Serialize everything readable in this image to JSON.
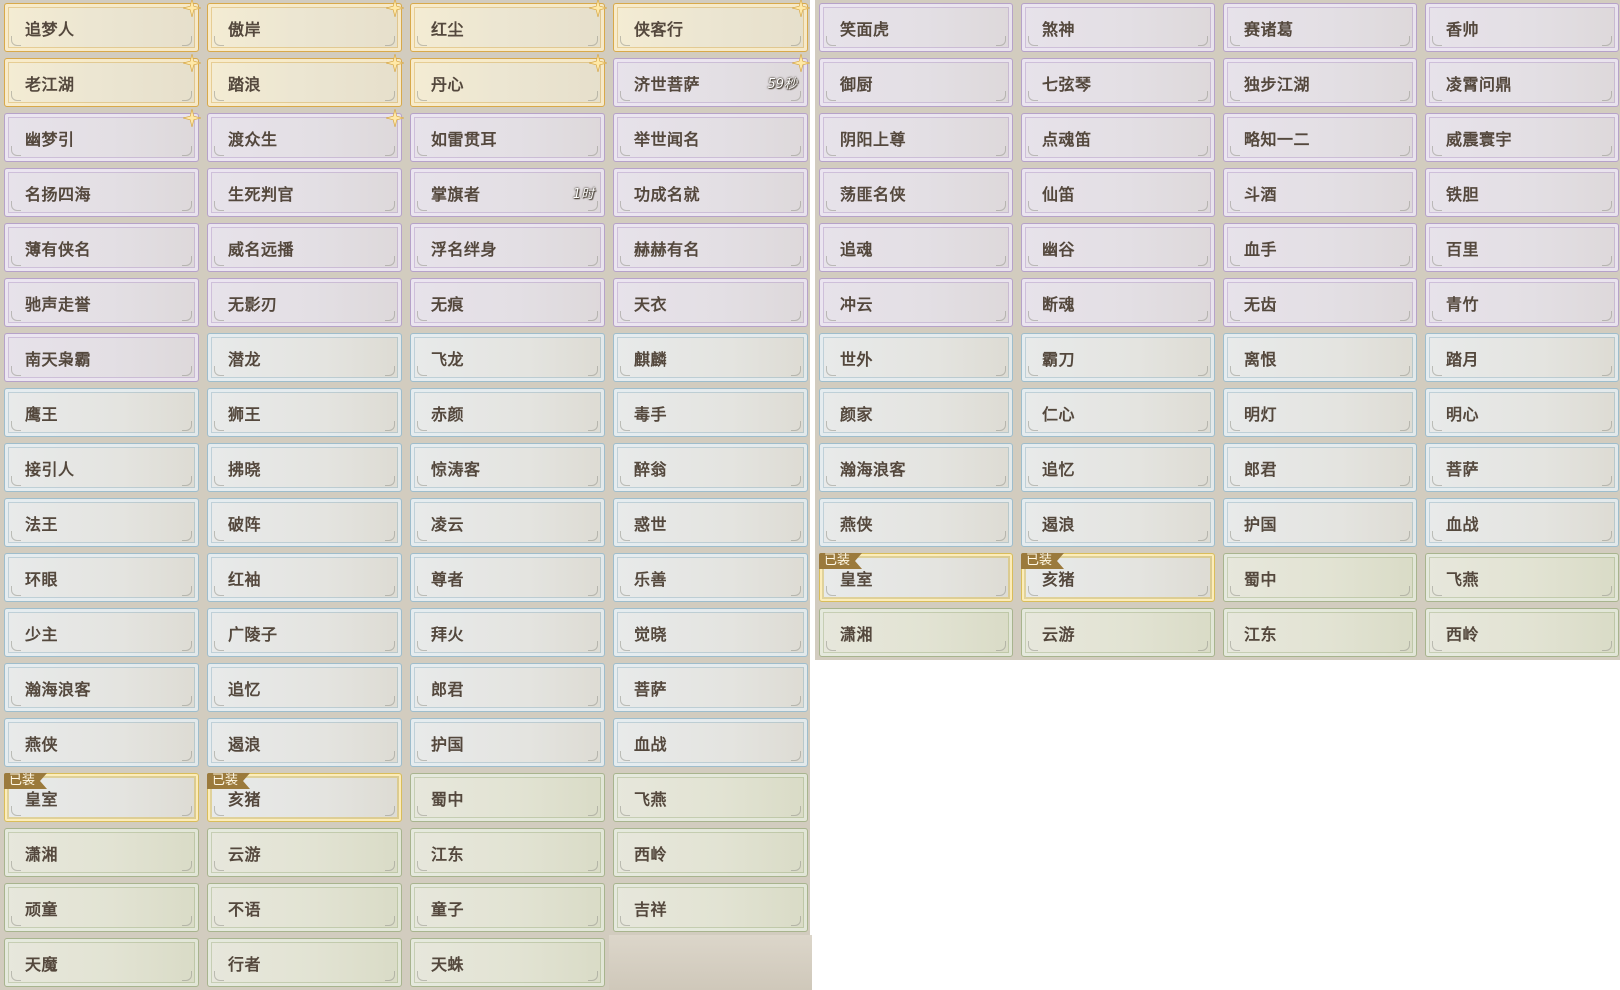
{
  "panels": [
    {
      "id": "left",
      "rows": [
        [
          {
            "label": "追梦人",
            "tier": "gold",
            "sparkle": true
          },
          {
            "label": "傲岸",
            "tier": "gold",
            "sparkle": true
          },
          {
            "label": "红尘",
            "tier": "gold",
            "sparkle": true
          },
          {
            "label": "侠客行",
            "tier": "gold",
            "sparkle": true
          }
        ],
        [
          {
            "label": "老江湖",
            "tier": "gold",
            "sparkle": true
          },
          {
            "label": "踏浪",
            "tier": "gold",
            "sparkle": true
          },
          {
            "label": "丹心",
            "tier": "gold",
            "sparkle": true
          },
          {
            "label": "济世菩萨",
            "tier": "purple",
            "sparkle": true,
            "timer": "59秒"
          }
        ],
        [
          {
            "label": "幽梦引",
            "tier": "purple",
            "sparkle": true
          },
          {
            "label": "渡众生",
            "tier": "purple",
            "sparkle": true
          },
          {
            "label": "如雷贯耳",
            "tier": "purple"
          },
          {
            "label": "举世闻名",
            "tier": "purple"
          }
        ],
        [
          {
            "label": "名扬四海",
            "tier": "purple"
          },
          {
            "label": "生死判官",
            "tier": "purple"
          },
          {
            "label": "掌旗者",
            "tier": "purple",
            "timer": "1时"
          },
          {
            "label": "功成名就",
            "tier": "purple"
          }
        ],
        [
          {
            "label": "薄有侠名",
            "tier": "purple"
          },
          {
            "label": "威名远播",
            "tier": "purple"
          },
          {
            "label": "浮名绊身",
            "tier": "purple"
          },
          {
            "label": "赫赫有名",
            "tier": "purple"
          }
        ],
        [
          {
            "label": "驰声走誉",
            "tier": "purple"
          },
          {
            "label": "无影刃",
            "tier": "purple"
          },
          {
            "label": "无痕",
            "tier": "purple"
          },
          {
            "label": "天衣",
            "tier": "purple"
          }
        ],
        [
          {
            "label": "南天枭霸",
            "tier": "purple"
          },
          {
            "label": "潜龙",
            "tier": "blue"
          },
          {
            "label": "飞龙",
            "tier": "blue"
          },
          {
            "label": "麒麟",
            "tier": "blue"
          }
        ],
        [
          {
            "label": "鹰王",
            "tier": "blue"
          },
          {
            "label": "狮王",
            "tier": "blue"
          },
          {
            "label": "赤颜",
            "tier": "blue"
          },
          {
            "label": "毒手",
            "tier": "blue"
          }
        ],
        [
          {
            "label": "接引人",
            "tier": "blue"
          },
          {
            "label": "拂晓",
            "tier": "blue"
          },
          {
            "label": "惊涛客",
            "tier": "blue"
          },
          {
            "label": "醉翁",
            "tier": "blue"
          }
        ],
        [
          {
            "label": "法王",
            "tier": "blue"
          },
          {
            "label": "破阵",
            "tier": "blue"
          },
          {
            "label": "凌云",
            "tier": "blue"
          },
          {
            "label": "惑世",
            "tier": "blue"
          }
        ],
        [
          {
            "label": "环眼",
            "tier": "blue"
          },
          {
            "label": "红袖",
            "tier": "blue"
          },
          {
            "label": "尊者",
            "tier": "blue"
          },
          {
            "label": "乐善",
            "tier": "blue"
          }
        ],
        [
          {
            "label": "少主",
            "tier": "blue"
          },
          {
            "label": "广陵子",
            "tier": "blue"
          },
          {
            "label": "拜火",
            "tier": "blue"
          },
          {
            "label": "觉晓",
            "tier": "blue"
          }
        ],
        [
          {
            "label": "瀚海浪客",
            "tier": "blue"
          },
          {
            "label": "追忆",
            "tier": "blue"
          },
          {
            "label": "郎君",
            "tier": "blue"
          },
          {
            "label": "菩萨",
            "tier": "blue"
          }
        ],
        [
          {
            "label": "燕侠",
            "tier": "blue"
          },
          {
            "label": "遏浪",
            "tier": "blue"
          },
          {
            "label": "护国",
            "tier": "blue"
          },
          {
            "label": "血战",
            "tier": "blue"
          }
        ],
        [
          {
            "label": "皇室",
            "tier": "blue",
            "badge": "已装"
          },
          {
            "label": "亥猪",
            "tier": "blue",
            "badge": "已装"
          },
          {
            "label": "蜀中",
            "tier": "green"
          },
          {
            "label": "飞燕",
            "tier": "green"
          }
        ],
        [
          {
            "label": "潇湘",
            "tier": "green"
          },
          {
            "label": "云游",
            "tier": "green"
          },
          {
            "label": "江东",
            "tier": "green"
          },
          {
            "label": "西岭",
            "tier": "green"
          }
        ],
        [
          {
            "label": "顽童",
            "tier": "green"
          },
          {
            "label": "不语",
            "tier": "green"
          },
          {
            "label": "童子",
            "tier": "green"
          },
          {
            "label": "吉祥",
            "tier": "green"
          }
        ],
        [
          {
            "label": "天魔",
            "tier": "green"
          },
          {
            "label": "行者",
            "tier": "green"
          },
          {
            "label": "天蛛",
            "tier": "green"
          },
          null
        ]
      ]
    },
    {
      "id": "right",
      "rows": [
        [
          {
            "label": "笑面虎",
            "tier": "purple"
          },
          {
            "label": "煞神",
            "tier": "purple"
          },
          {
            "label": "赛诸葛",
            "tier": "purple"
          },
          {
            "label": "香帅",
            "tier": "purple"
          }
        ],
        [
          {
            "label": "御厨",
            "tier": "purple"
          },
          {
            "label": "七弦琴",
            "tier": "purple"
          },
          {
            "label": "独步江湖",
            "tier": "purple"
          },
          {
            "label": "凌霄问鼎",
            "tier": "purple"
          }
        ],
        [
          {
            "label": "阴阳上尊",
            "tier": "purple"
          },
          {
            "label": "点魂笛",
            "tier": "purple"
          },
          {
            "label": "略知一二",
            "tier": "purple"
          },
          {
            "label": "威震寰宇",
            "tier": "purple"
          }
        ],
        [
          {
            "label": "荡匪名侠",
            "tier": "purple"
          },
          {
            "label": "仙笛",
            "tier": "purple"
          },
          {
            "label": "斗酒",
            "tier": "purple"
          },
          {
            "label": "铁胆",
            "tier": "purple"
          }
        ],
        [
          {
            "label": "追魂",
            "tier": "purple"
          },
          {
            "label": "幽谷",
            "tier": "purple"
          },
          {
            "label": "血手",
            "tier": "purple"
          },
          {
            "label": "百里",
            "tier": "purple"
          }
        ],
        [
          {
            "label": "冲云",
            "tier": "purple"
          },
          {
            "label": "断魂",
            "tier": "purple"
          },
          {
            "label": "无齿",
            "tier": "purple"
          },
          {
            "label": "青竹",
            "tier": "purple"
          }
        ],
        [
          {
            "label": "世外",
            "tier": "blue"
          },
          {
            "label": "霸刀",
            "tier": "blue"
          },
          {
            "label": "离恨",
            "tier": "blue"
          },
          {
            "label": "踏月",
            "tier": "blue"
          }
        ],
        [
          {
            "label": "颜家",
            "tier": "blue"
          },
          {
            "label": "仁心",
            "tier": "blue"
          },
          {
            "label": "明灯",
            "tier": "blue"
          },
          {
            "label": "明心",
            "tier": "blue"
          }
        ],
        [
          {
            "label": "瀚海浪客",
            "tier": "blue"
          },
          {
            "label": "追忆",
            "tier": "blue"
          },
          {
            "label": "郎君",
            "tier": "blue"
          },
          {
            "label": "菩萨",
            "tier": "blue"
          }
        ],
        [
          {
            "label": "燕侠",
            "tier": "blue"
          },
          {
            "label": "遏浪",
            "tier": "blue"
          },
          {
            "label": "护国",
            "tier": "blue"
          },
          {
            "label": "血战",
            "tier": "blue"
          }
        ],
        [
          {
            "label": "皇室",
            "tier": "blue",
            "badge": "已装"
          },
          {
            "label": "亥猪",
            "tier": "blue",
            "badge": "已装"
          },
          {
            "label": "蜀中",
            "tier": "green"
          },
          {
            "label": "飞燕",
            "tier": "green"
          }
        ],
        [
          {
            "label": "潇湘",
            "tier": "green"
          },
          {
            "label": "云游",
            "tier": "green"
          },
          {
            "label": "江东",
            "tier": "green"
          },
          {
            "label": "西岭",
            "tier": "green"
          }
        ]
      ]
    }
  ],
  "colors": {
    "gold": "#d8a94a",
    "purple": "#b6a2c9",
    "blue": "#9ebdcc",
    "green": "#a8b48e",
    "equipped_badge": "#9b7a3c",
    "text": "#54483d"
  },
  "icons": {
    "sparkle": "sparkle-icon"
  }
}
